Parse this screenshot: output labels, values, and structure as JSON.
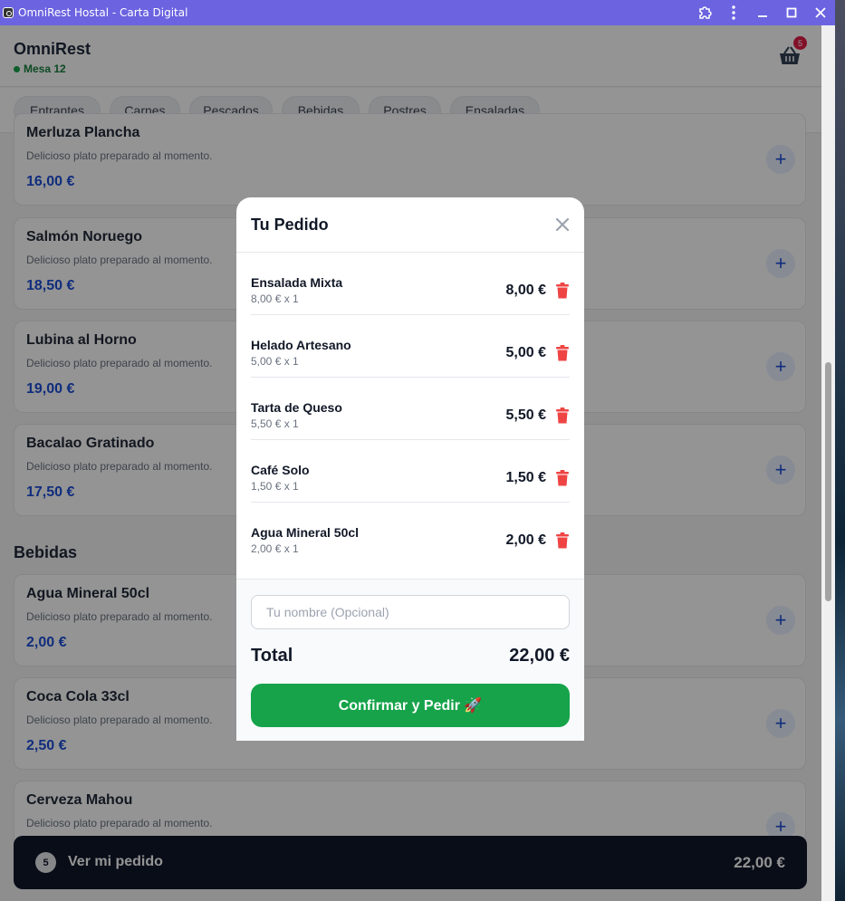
{
  "window": {
    "title": "OmniRest Hostal - Carta Digital"
  },
  "header": {
    "brand": "OmniRest",
    "table": "Mesa 12",
    "cart_count": "5"
  },
  "categories": [
    "Entrantes",
    "Carnes",
    "Pescados",
    "Bebidas",
    "Postres",
    "Ensaladas"
  ],
  "menu": {
    "items": [
      {
        "name": "Merluza Plancha",
        "desc": "Delicioso plato preparado al momento.",
        "price": "16,00 €"
      },
      {
        "name": "Salmón Noruego",
        "desc": "Delicioso plato preparado al momento.",
        "price": "18,50 €"
      },
      {
        "name": "Lubina al Horno",
        "desc": "Delicioso plato preparado al momento.",
        "price": "19,00 €"
      },
      {
        "name": "Bacalao Gratinado",
        "desc": "Delicioso plato preparado al momento.",
        "price": "17,50 €"
      }
    ],
    "section_bebidas": "Bebidas",
    "drinks": [
      {
        "name": "Agua Mineral 50cl",
        "desc": "Delicioso plato preparado al momento.",
        "price": "2,00 €"
      },
      {
        "name": "Coca Cola 33cl",
        "desc": "Delicioso plato preparado al momento.",
        "price": "2,50 €"
      },
      {
        "name": "Cerveza Mahou",
        "desc": "Delicioso plato preparado al momento.",
        "price": ""
      }
    ]
  },
  "bottom_bar": {
    "count": "5",
    "label": "Ver mi pedido",
    "total": "22,00 €"
  },
  "modal": {
    "title": "Tu Pedido",
    "items": [
      {
        "name": "Ensalada Mixta",
        "detail": "8,00 € x 1",
        "price": "8,00 €"
      },
      {
        "name": "Helado Artesano",
        "detail": "5,00 € x 1",
        "price": "5,00 €"
      },
      {
        "name": "Tarta de Queso",
        "detail": "5,50 € x 1",
        "price": "5,50 €"
      },
      {
        "name": "Café Solo",
        "detail": "1,50 € x 1",
        "price": "1,50 €"
      },
      {
        "name": "Agua Mineral 50cl",
        "detail": "2,00 € x 1",
        "price": "2,00 €"
      }
    ],
    "name_placeholder": "Tu nombre (Opcional)",
    "name_value": "",
    "total_label": "Total",
    "total_value": "22,00 €",
    "confirm_label": "Confirmar y Pedir 🚀"
  },
  "colors": {
    "accent": "#1d4ed8",
    "confirm": "#16a34a",
    "delete": "#ef4444",
    "titlebar": "#6b63e0"
  },
  "icons": [
    "close-icon",
    "trash-icon",
    "basket-icon",
    "plus-icon",
    "extension-icon",
    "kebab-menu-icon",
    "minimize-icon",
    "maximize-icon"
  ]
}
